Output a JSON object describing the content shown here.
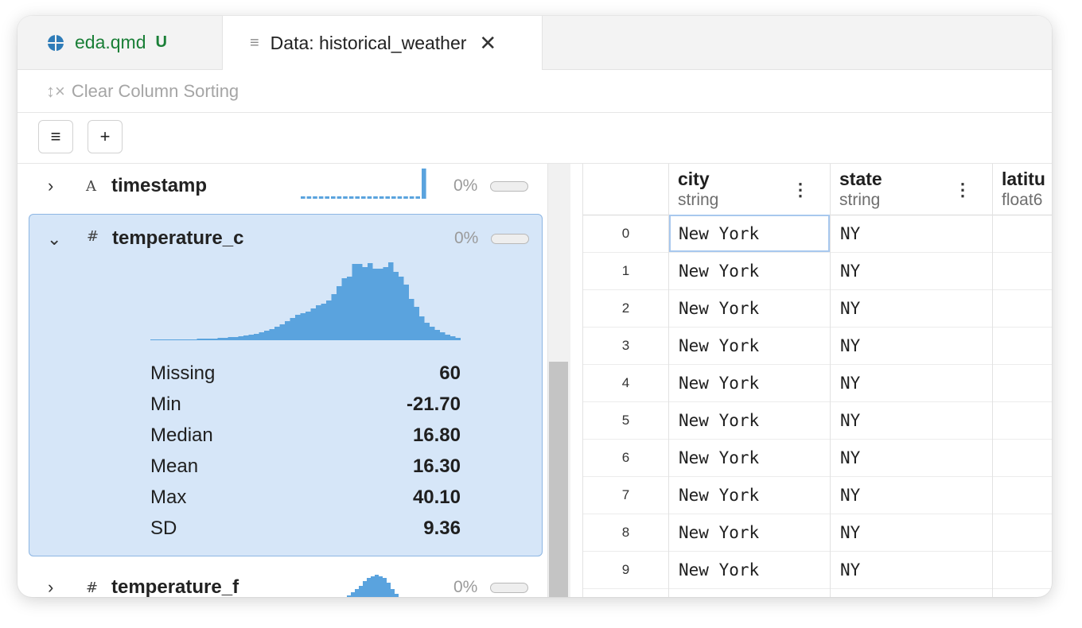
{
  "tabs": [
    {
      "label": "eda.qmd",
      "badge": "U"
    },
    {
      "label": "Data: historical_weather",
      "close": "✕"
    }
  ],
  "toolbar": {
    "clear_sorting_icon": "↕×",
    "clear_sorting_label": "Clear Column Sorting",
    "btn_layout_icon": "≡",
    "btn_add_icon": "+"
  },
  "summary": {
    "timestamp": {
      "chevron": "›",
      "type_icon": "A",
      "name": "timestamp",
      "missing_pct": "0%"
    },
    "temperature_c": {
      "chevron": "⌄",
      "type_icon": "#",
      "name": "temperature_c",
      "missing_pct": "0%",
      "stats": [
        {
          "label": "Missing",
          "value": "60"
        },
        {
          "label": "Min",
          "value": "-21.70"
        },
        {
          "label": "Median",
          "value": "16.80"
        },
        {
          "label": "Mean",
          "value": "16.30"
        },
        {
          "label": "Max",
          "value": "40.10"
        },
        {
          "label": "SD",
          "value": "9.36"
        }
      ]
    },
    "temperature_f": {
      "chevron": "›",
      "type_icon": "#",
      "name": "temperature_f",
      "missing_pct": "0%"
    }
  },
  "grid": {
    "columns": [
      {
        "name": "city",
        "type": "string",
        "menu": "⋮"
      },
      {
        "name": "state",
        "type": "string",
        "menu": "⋮"
      },
      {
        "name": "latitu",
        "type": "float6"
      }
    ],
    "rows": [
      {
        "index": "0",
        "city": "New York",
        "state": "NY"
      },
      {
        "index": "1",
        "city": "New York",
        "state": "NY"
      },
      {
        "index": "2",
        "city": "New York",
        "state": "NY"
      },
      {
        "index": "3",
        "city": "New York",
        "state": "NY"
      },
      {
        "index": "4",
        "city": "New York",
        "state": "NY"
      },
      {
        "index": "5",
        "city": "New York",
        "state": "NY"
      },
      {
        "index": "6",
        "city": "New York",
        "state": "NY"
      },
      {
        "index": "7",
        "city": "New York",
        "state": "NY"
      },
      {
        "index": "8",
        "city": "New York",
        "state": "NY"
      },
      {
        "index": "9",
        "city": "New York",
        "state": "NY"
      }
    ]
  },
  "colors": {
    "accent": "#5aa3de",
    "selected_bg": "#d6e6f8",
    "tab_green": "#1a7f37"
  }
}
